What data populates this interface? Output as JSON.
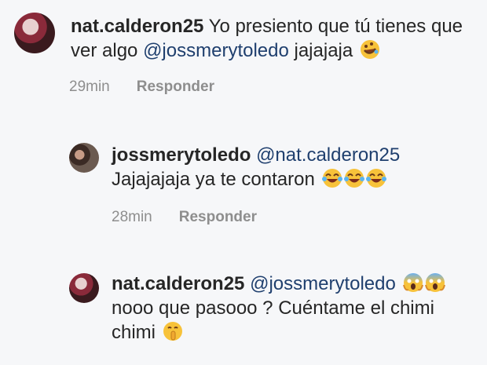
{
  "comments": [
    {
      "username": "nat.calderon25",
      "text_part1": " Yo presiento que tú tienes que ver algo ",
      "mention": "@jossmerytoledo",
      "text_part2": " jajajaja",
      "emoji": [
        "rofl-emoji"
      ],
      "time": "29min",
      "reply_label": "Responder"
    },
    {
      "username": "jossmerytoledo",
      "mention": "@nat.calderon25",
      "text": "Jajajajaja ya te contaron",
      "emoji": [
        "tears-of-joy-emoji",
        "tears-of-joy-emoji",
        "tears-of-joy-emoji"
      ],
      "time": "28min",
      "reply_label": "Responder"
    },
    {
      "username": "nat.calderon25",
      "mention": "@jossmerytoledo",
      "text": "nooo que pasooo ? Cuéntame el chimi chimi",
      "emoji_after_mention": [
        "screaming-emoji",
        "screaming-emoji"
      ],
      "emoji": [
        "shushing-emoji"
      ]
    }
  ],
  "colors": {
    "background": "#f6f7f9",
    "mention": "#1f3f6e",
    "meta": "#8e8e8e"
  }
}
